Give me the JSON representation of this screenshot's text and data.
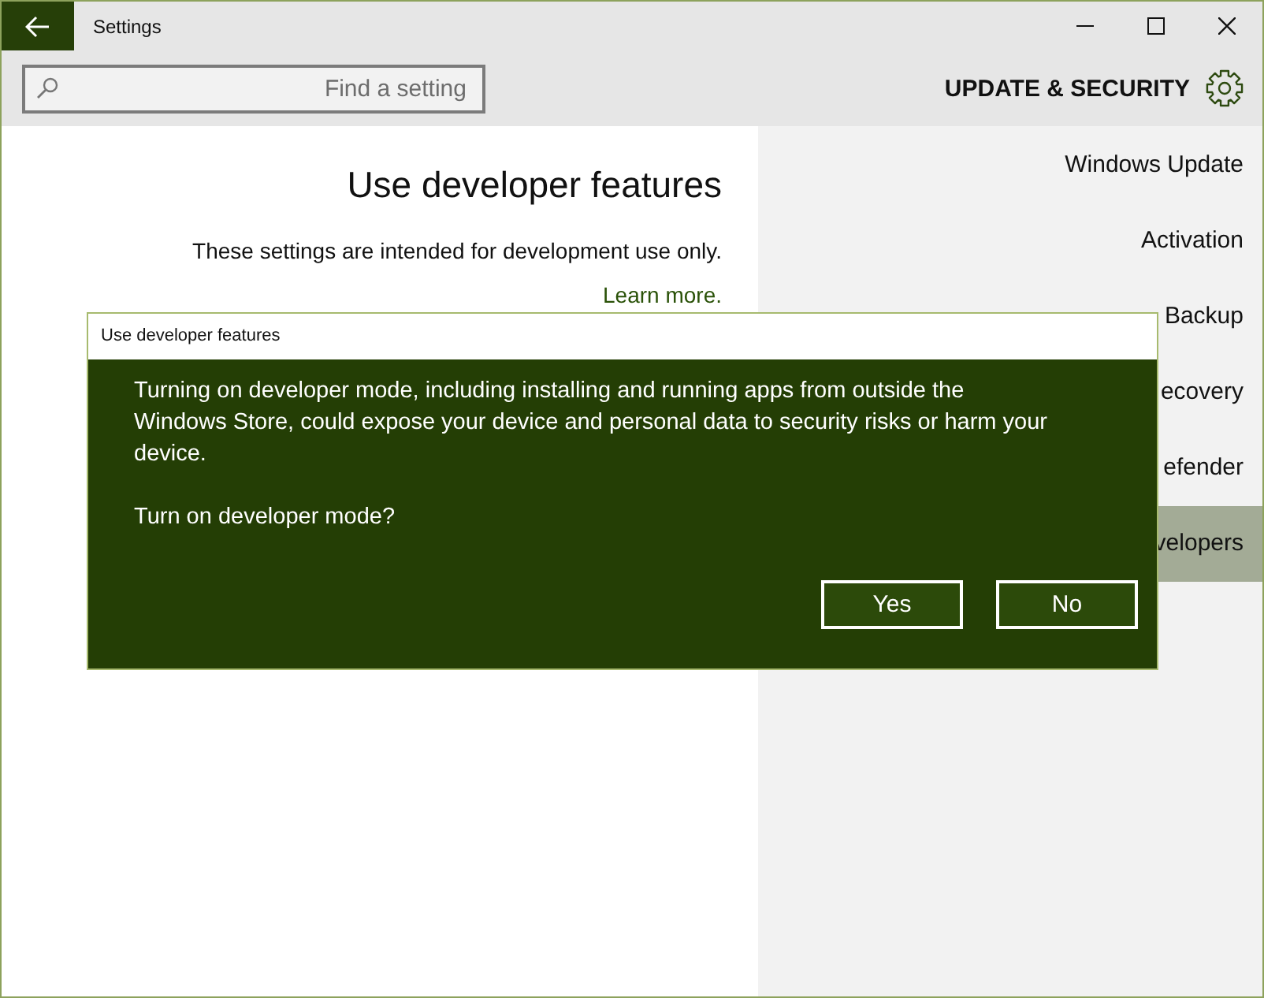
{
  "window": {
    "title": "Settings"
  },
  "search": {
    "placeholder": "Find a setting"
  },
  "section": {
    "title": "UPDATE & SECURITY"
  },
  "page": {
    "title": "Use developer features",
    "description": "These settings are intended for development use only.",
    "link": "Learn more."
  },
  "sidebar": {
    "items": [
      {
        "label": "Windows Update",
        "selected": false
      },
      {
        "label": "Activation",
        "selected": false
      },
      {
        "label": "Backup",
        "selected": false
      },
      {
        "label": "ecovery",
        "selected": false
      },
      {
        "label": "efender",
        "selected": false
      },
      {
        "label": "velopers",
        "selected": true
      }
    ]
  },
  "dialog": {
    "title": "Use developer features",
    "message": [
      "Turning on developer mode, including installing and running apps from outside the Windows Store, could expose your device and personal data to security risks or harm your device.",
      "Turn on developer mode?"
    ],
    "buttons": [
      "Yes",
      "No"
    ]
  }
}
